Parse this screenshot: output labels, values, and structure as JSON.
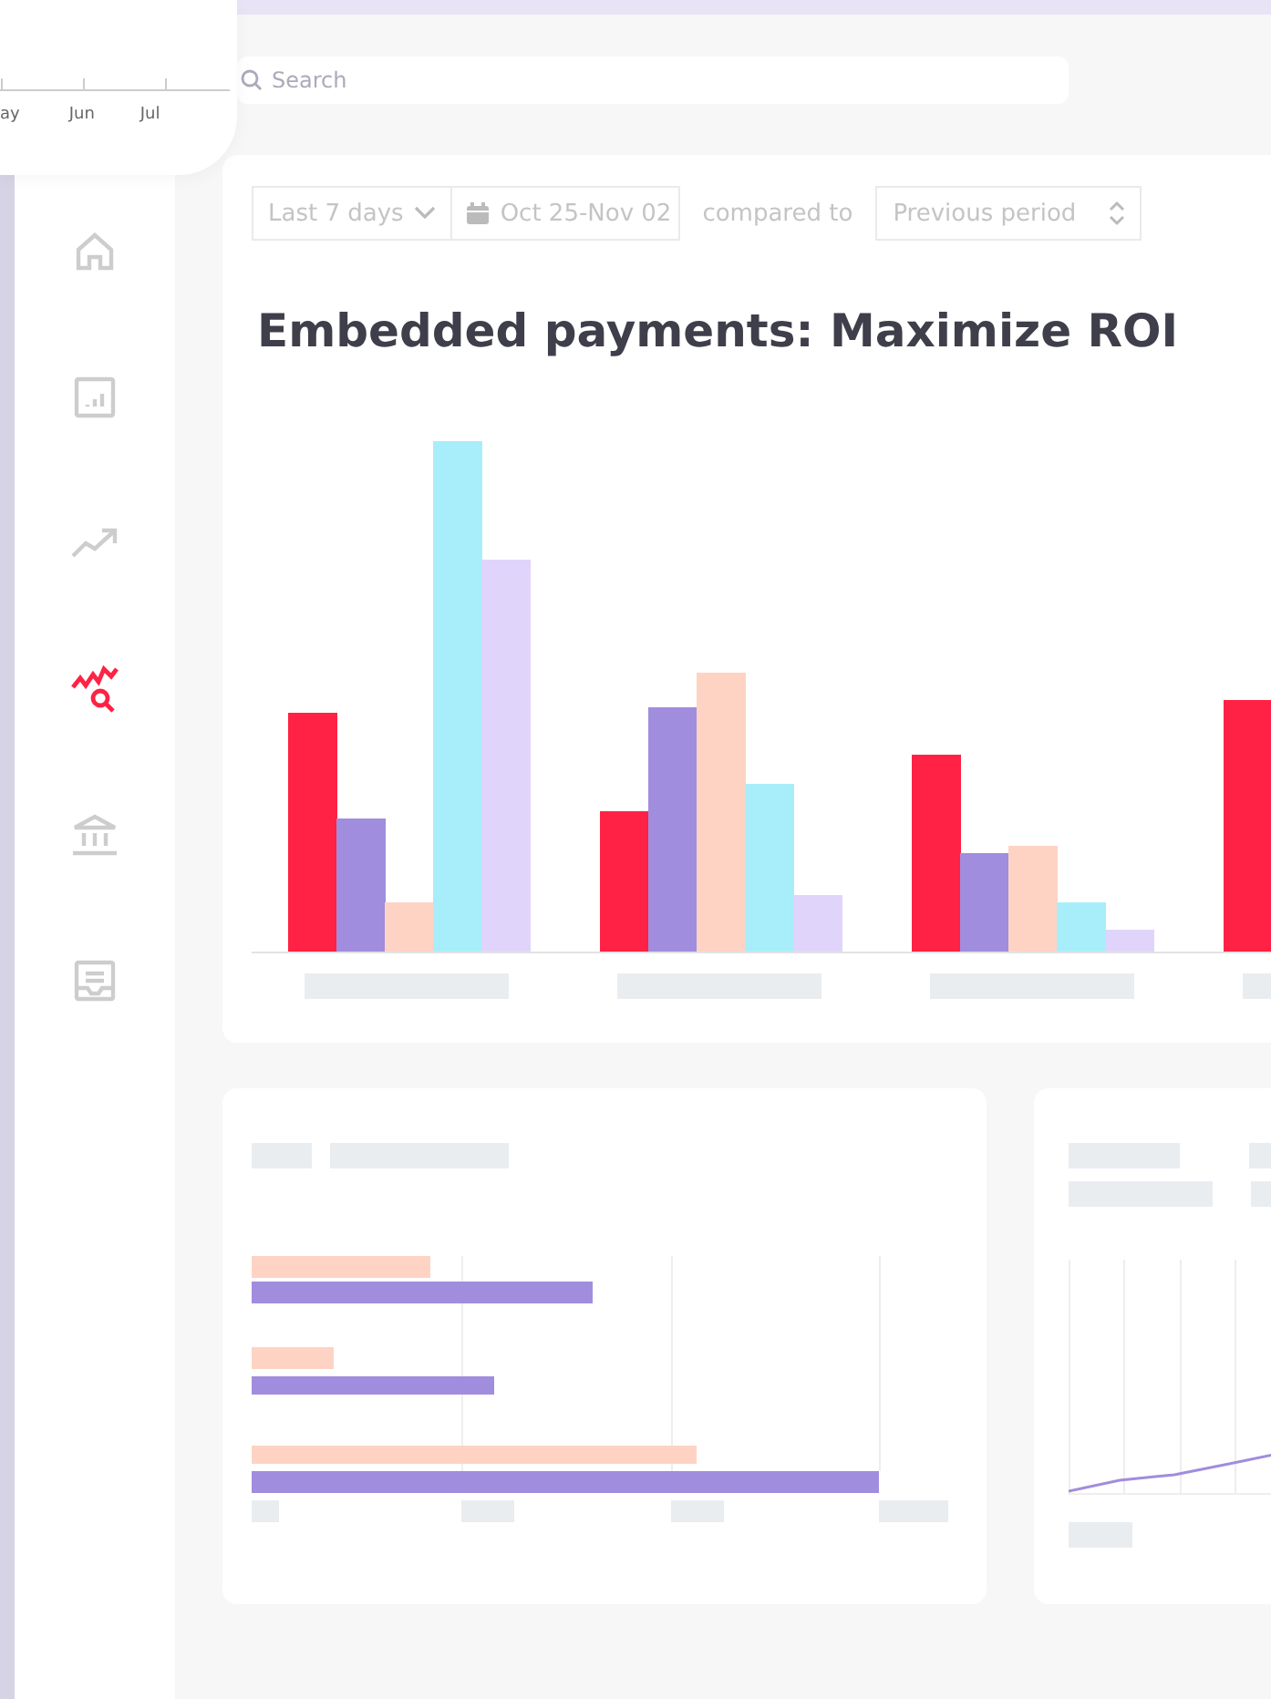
{
  "mini_chart": {
    "axis_labels": [
      "ay",
      "Jun",
      "Jul"
    ]
  },
  "sidebar": {
    "items": [
      {
        "selected": false
      },
      {
        "selected": false
      },
      {
        "selected": false
      },
      {
        "selected": true
      },
      {
        "selected": false
      },
      {
        "selected": false
      }
    ]
  },
  "search": {
    "placeholder": "Search"
  },
  "filters": {
    "range": "Last 7 days",
    "dates": "Oct 25-Nov 02",
    "compare_label": "compared to",
    "compare": "Previous period"
  },
  "title": "Embedded payments: Maximize ROI"
}
